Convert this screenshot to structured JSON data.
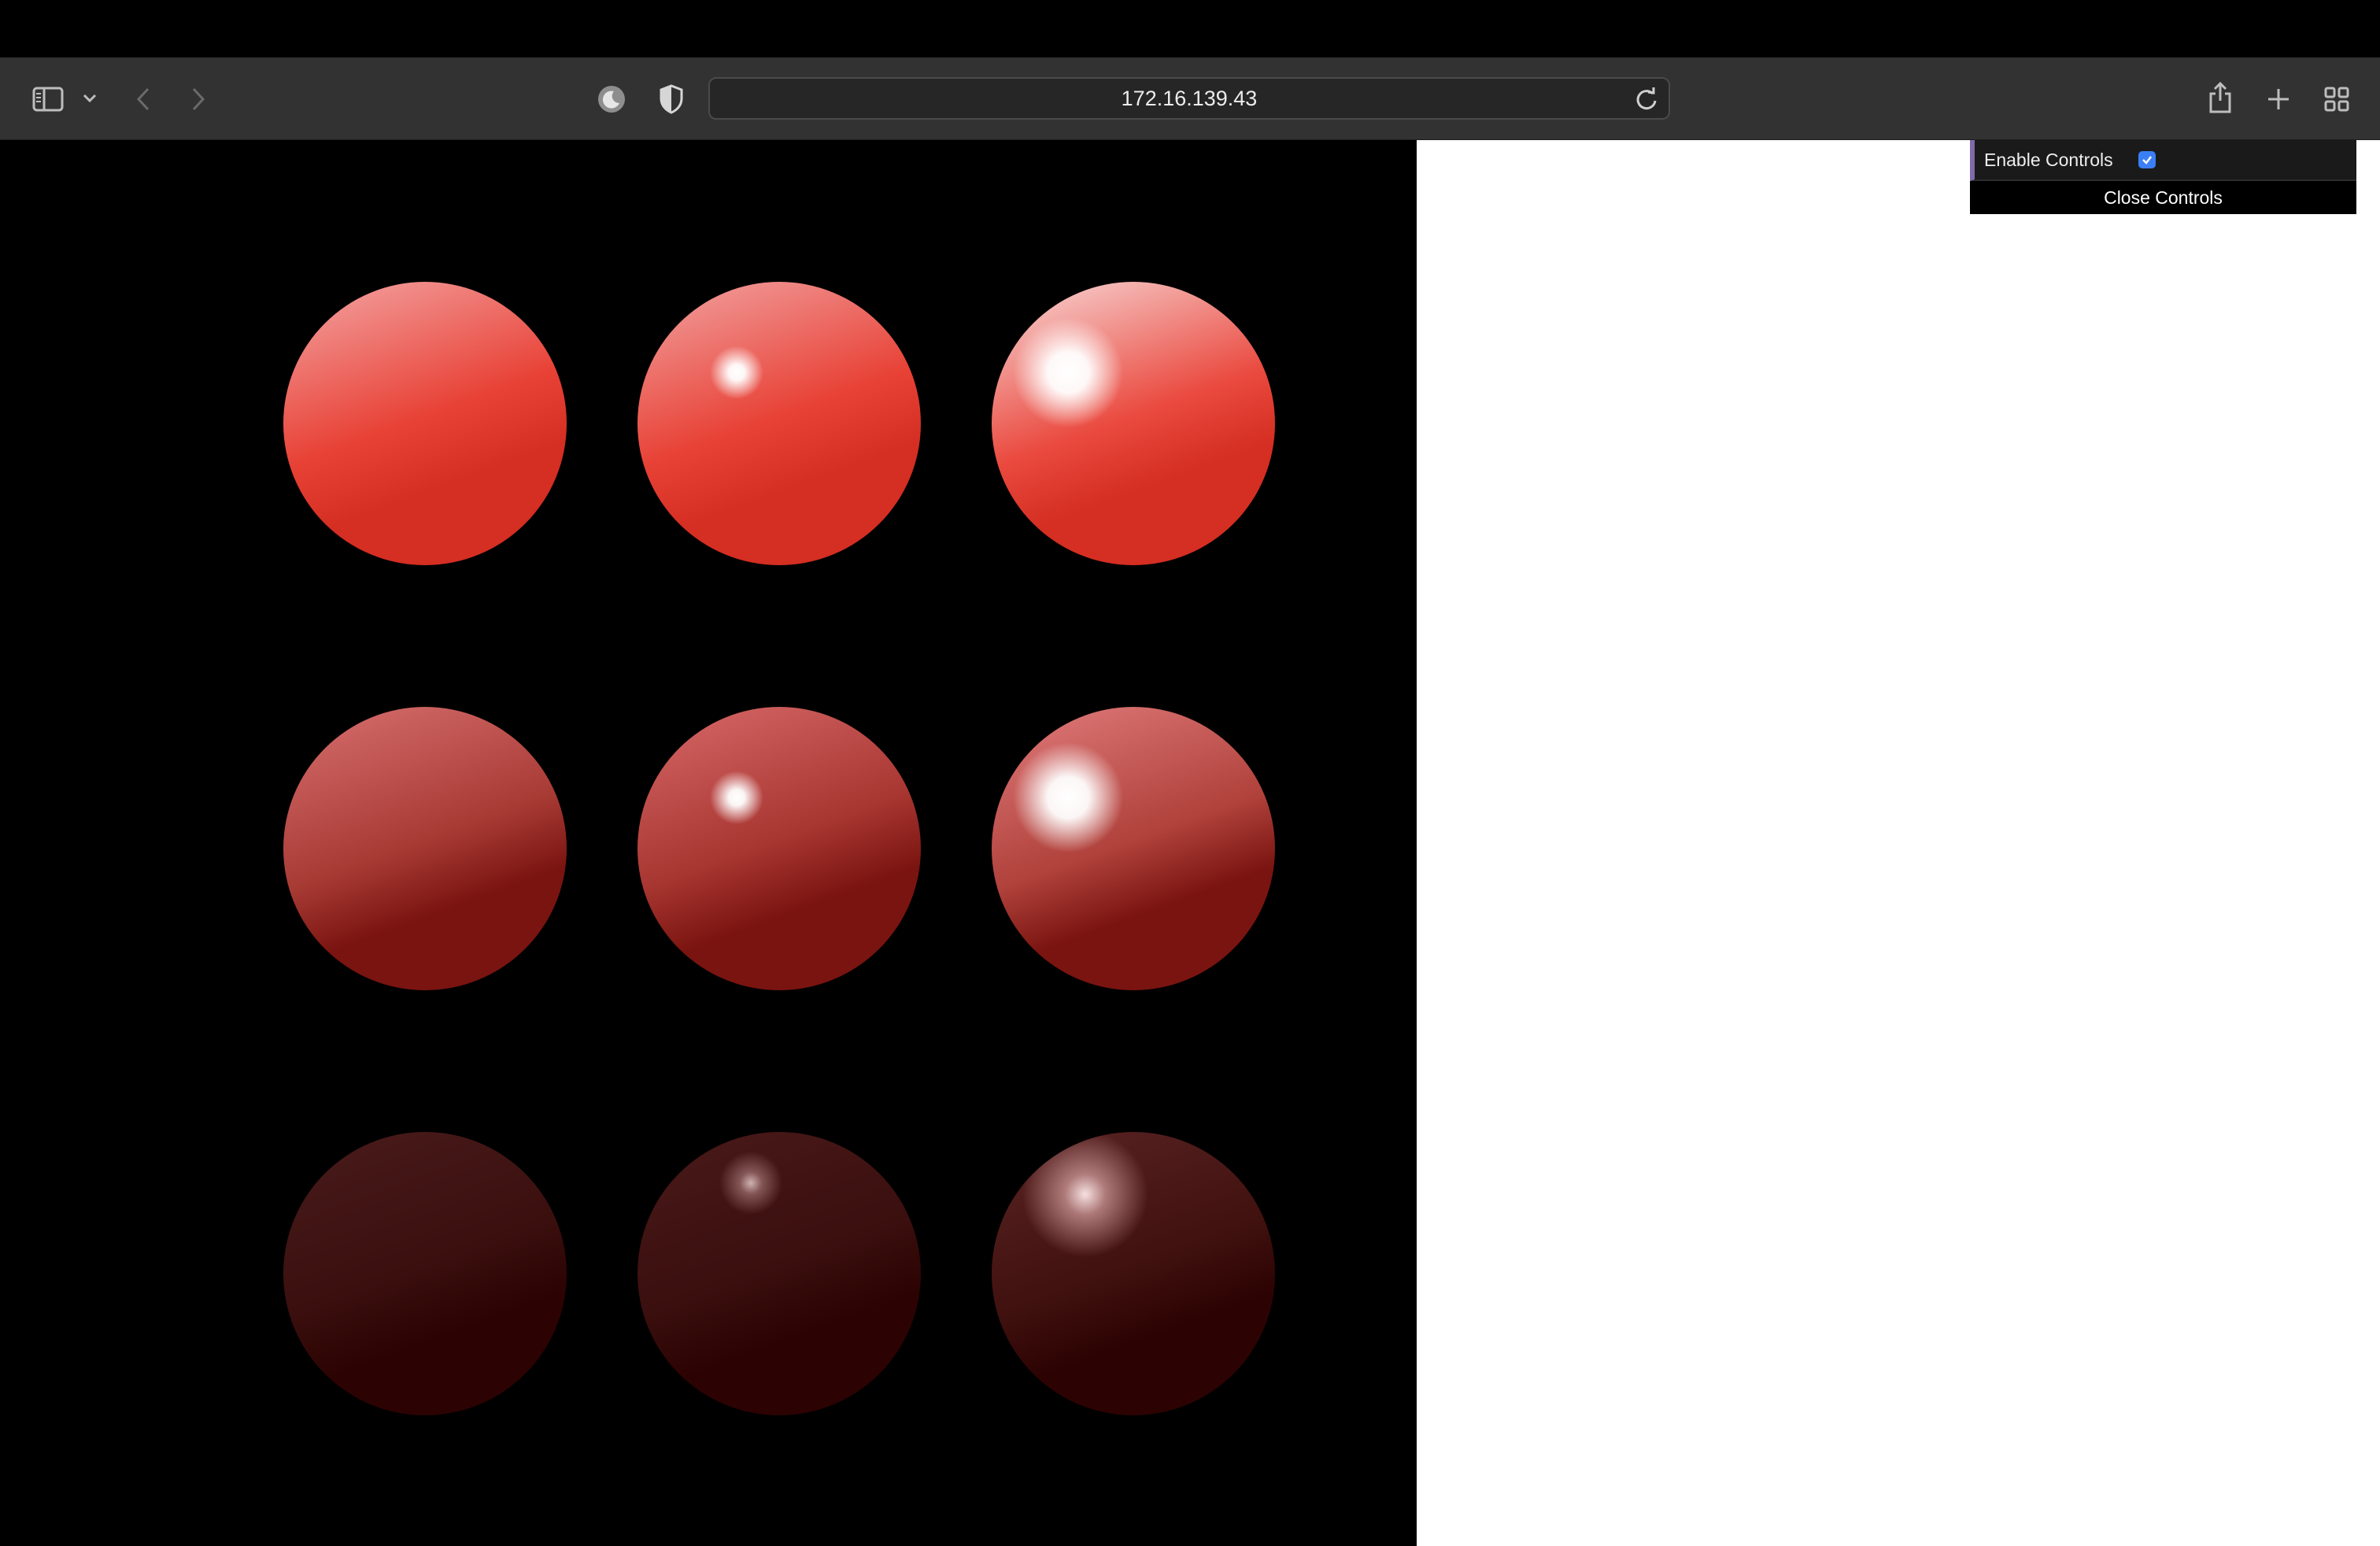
{
  "browser": {
    "url": "172.16.139.43",
    "icons": {
      "sidebar": "sidebar-icon",
      "sidebar_menu": "chevron-down-icon",
      "back": "back-arrow-icon",
      "forward": "forward-arrow-icon",
      "dark_mode": "moon-icon",
      "privacy": "shield-icon",
      "reload": "reload-icon",
      "share": "share-icon",
      "new_tab": "plus-icon",
      "tab_overview": "grid-icon"
    },
    "colors": {
      "toolbar": "#323232",
      "address_bar": "#262626"
    }
  },
  "scene": {
    "background": "#000000",
    "sphere_color": "#e3322a",
    "rows": [
      {
        "spheres": [
          {
            "base": "#d52e22",
            "mid": "#e84236",
            "light": "#f4a6a6",
            "highlight": "none"
          },
          {
            "base": "#d52e22",
            "mid": "#e84236",
            "light": "#f2a4a4",
            "highlight": "small"
          },
          {
            "base": "#d52e22",
            "mid": "#ea4a3f",
            "light": "#f8dada",
            "highlight": "large"
          }
        ]
      },
      {
        "spheres": [
          {
            "base": "#7a1410",
            "mid": "#a83a34",
            "light": "#d87070",
            "highlight": "none"
          },
          {
            "base": "#7a1410",
            "mid": "#a73530",
            "light": "#d86a6a",
            "highlight": "small"
          },
          {
            "base": "#7a1410",
            "mid": "#b0413b",
            "light": "#e07c7c",
            "highlight": "large"
          }
        ]
      },
      {
        "spheres": [
          {
            "base": "#2c0302",
            "mid": "#3a0f0e",
            "light": "#4a1c1c",
            "highlight": "none"
          },
          {
            "base": "#2c0302",
            "mid": "#3a0f0e",
            "light": "#4a1a1a",
            "highlight": "dim"
          },
          {
            "base": "#2c0302",
            "mid": "#40110f",
            "light": "#5a2424",
            "highlight": "dim-large"
          }
        ]
      }
    ]
  },
  "controls": {
    "enable_label": "Enable Controls",
    "enable_checked": true,
    "close_label": "Close Controls",
    "accent": "#806aa8",
    "checkbox_color": "#3b7ff5"
  }
}
